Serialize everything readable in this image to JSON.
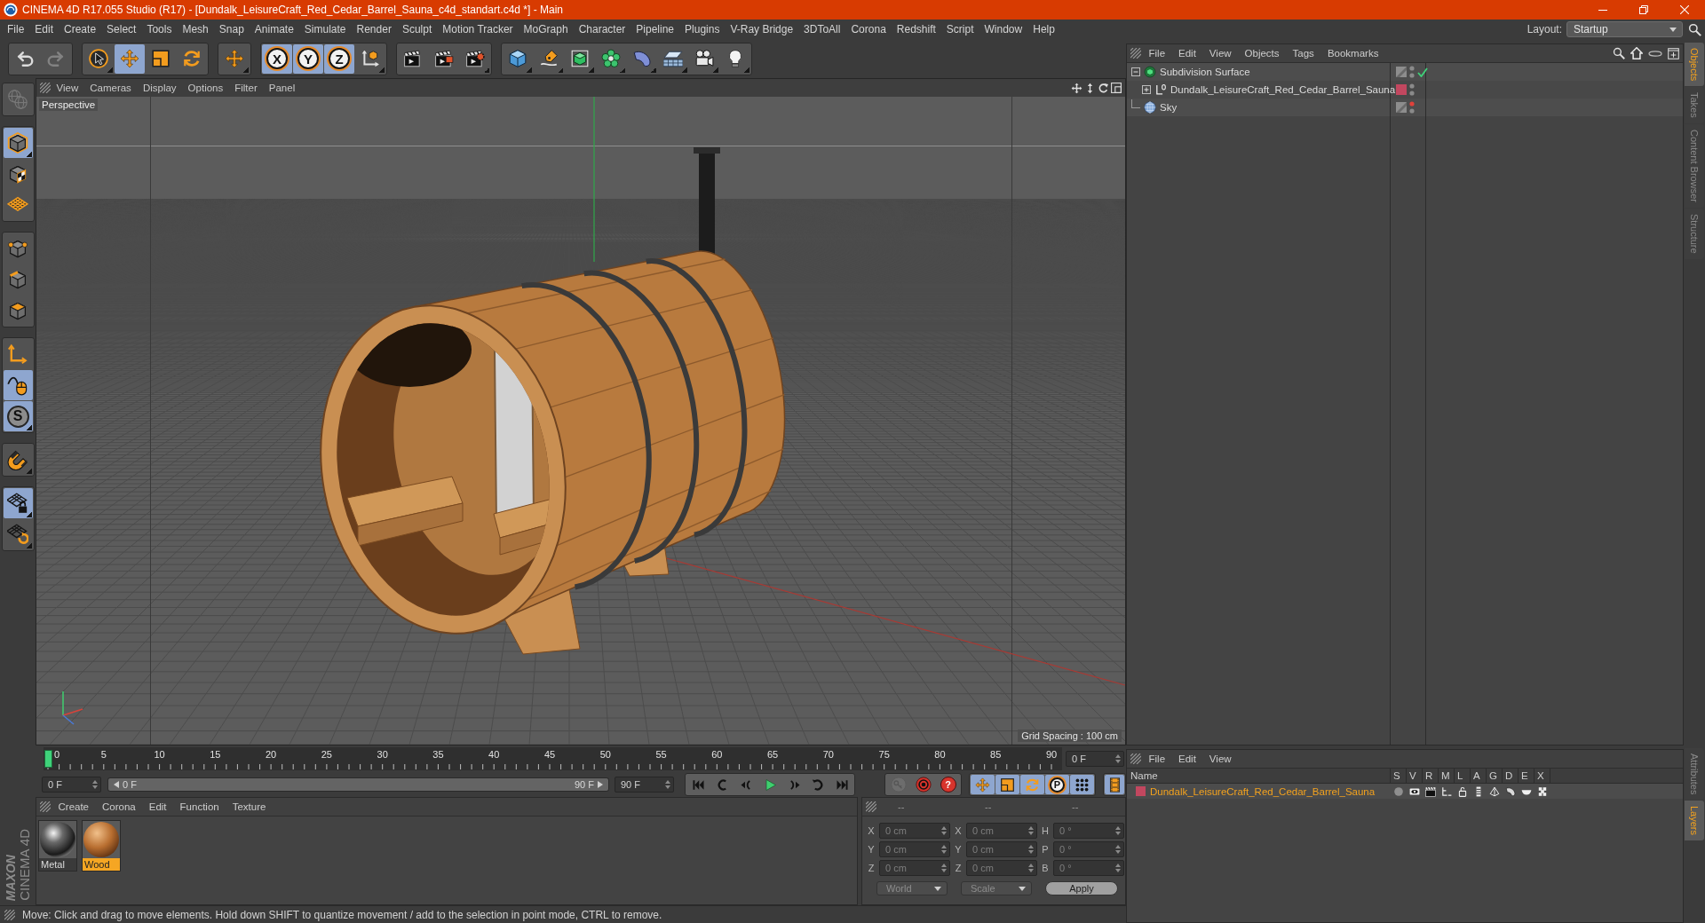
{
  "window": {
    "title": "CINEMA 4D R17.055 Studio (R17) - [Dundalk_LeisureCraft_Red_Cedar_Barrel_Sauna_c4d_standart.c4d *] - Main"
  },
  "menu": [
    "File",
    "Edit",
    "Create",
    "Select",
    "Tools",
    "Mesh",
    "Snap",
    "Animate",
    "Simulate",
    "Render",
    "Sculpt",
    "Motion Tracker",
    "MoGraph",
    "Character",
    "Pipeline",
    "Plugins",
    "V-Ray Bridge",
    "3DToAll",
    "Corona",
    "Redshift",
    "Script",
    "Window",
    "Help"
  ],
  "layout": {
    "label": "Layout:",
    "value": "Startup"
  },
  "toolbar": [
    {
      "tools": [
        {
          "kind": "undo",
          "selected": false,
          "disabled": false
        },
        {
          "kind": "redo",
          "selected": false,
          "disabled": true
        }
      ]
    },
    {
      "tools": [
        {
          "kind": "select",
          "selected": false
        },
        {
          "kind": "move",
          "selected": true
        },
        {
          "kind": "scale",
          "selected": false
        },
        {
          "kind": "rotate",
          "selected": false
        }
      ]
    },
    {
      "tools": [
        {
          "kind": "add",
          "selected": false
        }
      ]
    },
    {
      "tools": [
        {
          "kind": "constraint",
          "label": "X",
          "selected": true
        },
        {
          "kind": "constraint",
          "label": "Y",
          "selected": true
        },
        {
          "kind": "constraint",
          "label": "Z",
          "selected": true
        },
        {
          "kind": "coords",
          "selected": false
        }
      ]
    },
    {
      "tools": [
        {
          "kind": "renderview",
          "selected": false
        },
        {
          "kind": "renderpicture",
          "selected": false
        },
        {
          "kind": "rendersettings",
          "selected": false
        }
      ]
    },
    {
      "tools": [
        {
          "kind": "cube",
          "selected": false
        },
        {
          "kind": "pen",
          "selected": false
        },
        {
          "kind": "subdivision",
          "selected": false
        },
        {
          "kind": "cloner",
          "selected": false
        },
        {
          "kind": "deformer",
          "selected": false
        },
        {
          "kind": "floor",
          "selected": false
        },
        {
          "kind": "camera",
          "selected": false
        },
        {
          "kind": "light",
          "selected": false
        }
      ]
    }
  ],
  "modes": [
    {
      "tools": [
        {
          "kind": "viewport",
          "selected": false,
          "disabled": true
        }
      ]
    },
    {
      "tools": [
        {
          "kind": "model",
          "selected": true
        },
        {
          "kind": "texture",
          "selected": false
        },
        {
          "kind": "workplane",
          "selected": false
        }
      ]
    },
    {
      "tools": [
        {
          "kind": "points",
          "selected": false
        },
        {
          "kind": "edges",
          "selected": false
        },
        {
          "kind": "polygons",
          "selected": false
        }
      ]
    },
    {
      "tools": [
        {
          "kind": "axis",
          "selected": false
        },
        {
          "kind": "tweak",
          "selected": true
        },
        {
          "kind": "snap",
          "label": "S",
          "selected": true
        }
      ]
    },
    {
      "tools": [
        {
          "kind": "magnet",
          "selected": false
        }
      ]
    },
    {
      "tools": [
        {
          "kind": "lock",
          "selected": true
        },
        {
          "kind": "gridrotate",
          "selected": false
        }
      ]
    }
  ],
  "logo": {
    "brand": "MAXON",
    "product": "CINEMA 4D"
  },
  "viewport": {
    "menu": [
      "View",
      "Cameras",
      "Display",
      "Options",
      "Filter",
      "Panel"
    ],
    "camera": "Perspective",
    "grid_spacing": "Grid Spacing : 100 cm"
  },
  "timeline": {
    "ticks": [
      "0",
      "5",
      "10",
      "15",
      "20",
      "25",
      "30",
      "35",
      "40",
      "45",
      "50",
      "55",
      "60",
      "65",
      "70",
      "75",
      "80",
      "85",
      "90"
    ],
    "level": 0,
    "frame": "0 F"
  },
  "playback": {
    "start_field": "0 F",
    "range_start": "0 F",
    "range_end": "90 F",
    "level": 1,
    "end_field": "90 F",
    "transport": [
      {
        "kind": "start"
      },
      {
        "kind": "prevkey"
      },
      {
        "kind": "prevframe"
      },
      {
        "kind": "play"
      },
      {
        "kind": "nextframe"
      },
      {
        "kind": "nextkey"
      },
      {
        "kind": "end"
      }
    ],
    "record": [
      {
        "kind": "key",
        "disabled": true
      },
      {
        "kind": "autokey",
        "disabled": false
      },
      {
        "kind": "keyframes",
        "label": "?",
        "disabled": false
      }
    ],
    "keytools": [
      {
        "kind": "position",
        "selected": true
      },
      {
        "kind": "scaling",
        "selected": true
      },
      {
        "kind": "rotation",
        "selected": true
      },
      {
        "kind": "parameter",
        "label": "P",
        "selected": true
      },
      {
        "kind": "pointlevel",
        "selected": true
      }
    ],
    "timeline_toggle": {
      "selected": true
    }
  },
  "materials": {
    "menu": [
      "Create",
      "Corona",
      "Edit",
      "Function",
      "Texture"
    ],
    "items": [
      {
        "name": "Metal",
        "kind": "metal",
        "selected": false
      },
      {
        "name": "Wood",
        "kind": "wood",
        "selected": true
      }
    ]
  },
  "coordinates": {
    "headers": [
      "--",
      "--",
      "--"
    ],
    "rows": [
      [
        {
          "axis": "X",
          "value": "0 cm"
        },
        {
          "axis": "X",
          "value": "0 cm"
        },
        {
          "axis": "H",
          "value": "0 °"
        }
      ],
      [
        {
          "axis": "Y",
          "value": "0 cm"
        },
        {
          "axis": "Y",
          "value": "0 cm"
        },
        {
          "axis": "P",
          "value": "0 °"
        }
      ],
      [
        {
          "axis": "Z",
          "value": "0 cm"
        },
        {
          "axis": "Z",
          "value": "0 cm"
        },
        {
          "axis": "B",
          "value": "0 °"
        }
      ]
    ],
    "mode": "World",
    "transform": "Scale",
    "apply": "Apply"
  },
  "status_bar": "Move: Click and drag to move elements. Hold down SHIFT to quantize movement / add to the selection in point mode, CTRL to remove.",
  "objects": {
    "menu": [
      "File",
      "Edit",
      "View",
      "Objects",
      "Tags",
      "Bookmarks"
    ],
    "tree": [
      {
        "name": "Subdivision Surface",
        "kind": "subdivision",
        "expandable": true,
        "expanded": true,
        "hidden_in_editor": false,
        "check": true,
        "children": [
          {
            "name": "Dundalk_LeisureCraft_Red_Cedar_Barrel_Sauna",
            "kind": "null",
            "expandable": true,
            "expanded": false,
            "hidden_in_editor": false,
            "check": false,
            "color": "#c2475f"
          }
        ]
      },
      {
        "name": "Sky",
        "kind": "sky",
        "expandable": false,
        "hidden_in_editor": true,
        "check": false
      }
    ]
  },
  "layers": {
    "menu": [
      "File",
      "Edit",
      "View"
    ],
    "columns": [
      "Name",
      "S",
      "V",
      "R",
      "M",
      "L",
      "A",
      "G",
      "D",
      "E",
      "X"
    ],
    "rows": [
      {
        "name": "Dundalk_LeisureCraft_Red_Cedar_Barrel_Sauna",
        "color": "#c2475f",
        "selected": true
      }
    ]
  },
  "side_tabs": {
    "top": [
      {
        "label": "Objects",
        "selected": true
      },
      {
        "label": "Takes",
        "selected": false
      },
      {
        "label": "Content Browser",
        "selected": false
      },
      {
        "label": "Structure",
        "selected": false
      }
    ],
    "bottom": [
      {
        "label": "Attributes",
        "selected": false
      },
      {
        "label": "Layers",
        "selected": true
      }
    ]
  }
}
